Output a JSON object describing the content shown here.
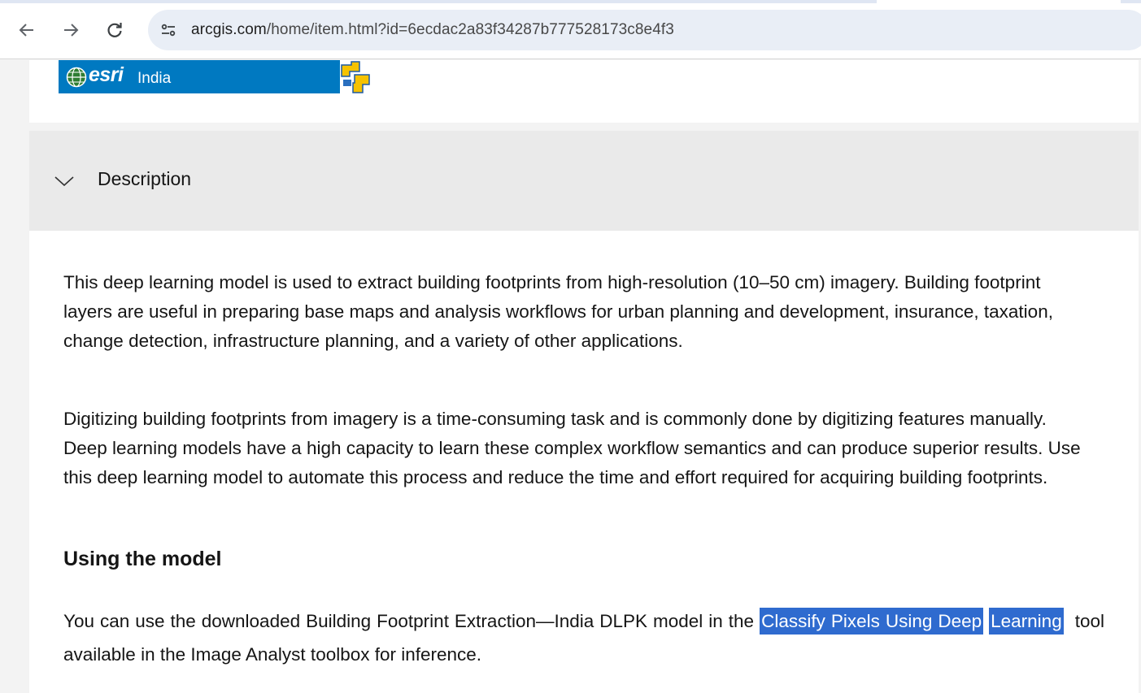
{
  "browser": {
    "url_host": "arcgis.com",
    "url_path": "/home/item.html?id=6ecdac2a83f34287b777528173c8e4f3",
    "back_icon": "arrow-left-icon",
    "forward_icon": "arrow-right-icon",
    "reload_icon": "reload-icon",
    "site_info_icon": "site-settings-icon"
  },
  "banner": {
    "brand": "esri",
    "region": "India",
    "colors": {
      "background": "#0079c1"
    }
  },
  "description": {
    "title": "Description",
    "chevron_icon": "chevron-down-icon",
    "paragraph1": "This deep learning model is used to extract building footprints from high-resolution (10–50 cm) imagery. Building footprint layers are useful in preparing base maps and analysis workflows for urban planning and development, insurance, taxation, change detection, infrastructure planning, and a variety of other applications.",
    "paragraph2": "Digitizing building footprints from imagery is a time-consuming task and is commonly done by digitizing features manually. Deep learning models have a high capacity to learn these complex workflow semantics and can produce superior results. Use this deep learning model to automate this process and reduce the time and effort required for acquiring building footprints.",
    "heading": "Using the model",
    "usage": {
      "before_link": "You can use the downloaded Building Footprint Extraction—India DLPK model in the",
      "link_part1": "Classify Pixels Using Deep",
      "link_part2": "Learning",
      "after_link": "tool available in the Image Analyst toolbox for inference."
    },
    "selection_color": "#2f6bcf"
  }
}
